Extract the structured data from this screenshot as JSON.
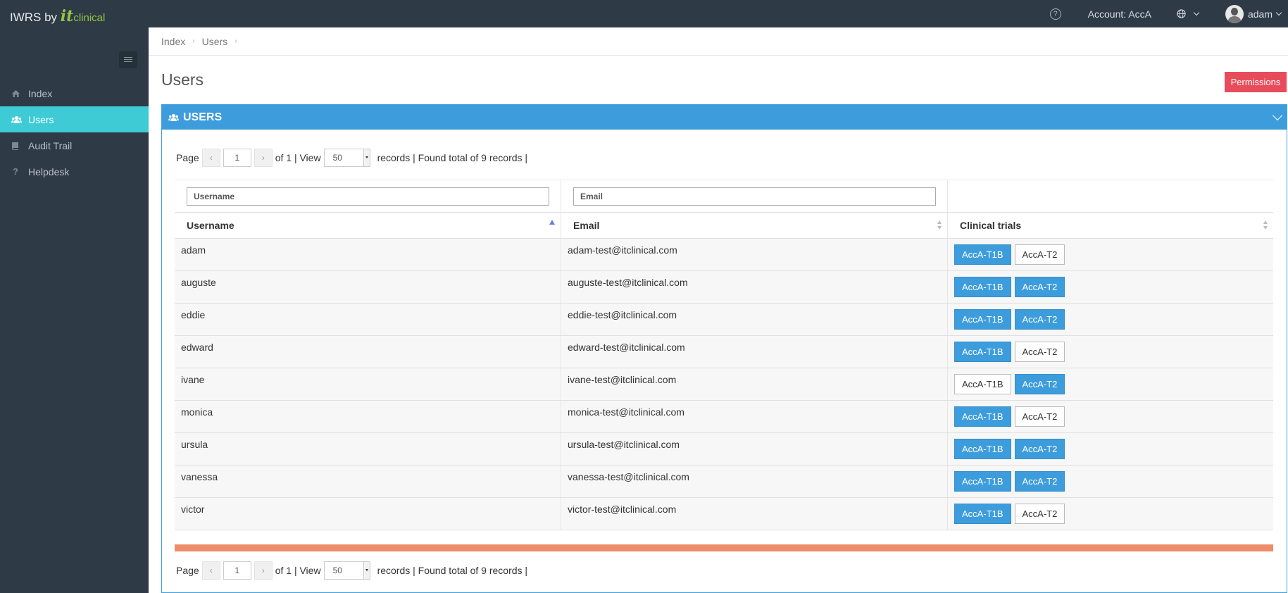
{
  "brand": {
    "text": "IWRS by",
    "logo_it": "it",
    "logo_clinical": "clinical"
  },
  "topbar": {
    "help": "?",
    "account": "Account: AccA",
    "user": "adam"
  },
  "sidebar": {
    "items": [
      {
        "label": "Index",
        "icon": "home-icon",
        "active": false
      },
      {
        "label": "Users",
        "icon": "users-icon",
        "active": true
      },
      {
        "label": "Audit Trail",
        "icon": "book-icon",
        "active": false
      },
      {
        "label": "Helpdesk",
        "icon": "question-icon",
        "active": false
      }
    ]
  },
  "breadcrumb": {
    "items": [
      "Index",
      "Users"
    ],
    "sep": "›"
  },
  "page": {
    "title": "Users",
    "permissions_label": "Permissions"
  },
  "panel": {
    "title": "USERS"
  },
  "pager": {
    "page_label": "Page",
    "prev": "‹",
    "next": "›",
    "page": "1",
    "of_text": "of 1 | View",
    "view": "50",
    "records_text": "records | Found total of 9 records |"
  },
  "filters": {
    "username_placeholder": "Username",
    "email_placeholder": "Email"
  },
  "columns": [
    "Username",
    "Email",
    "Clinical trials"
  ],
  "trials": [
    "AccA-T1B",
    "AccA-T2"
  ],
  "rows": [
    {
      "username": "adam",
      "email": "adam-test@itclinical.com",
      "t1b": true,
      "t2": false
    },
    {
      "username": "auguste",
      "email": "auguste-test@itclinical.com",
      "t1b": true,
      "t2": true
    },
    {
      "username": "eddie",
      "email": "eddie-test@itclinical.com",
      "t1b": true,
      "t2": true
    },
    {
      "username": "edward",
      "email": "edward-test@itclinical.com",
      "t1b": true,
      "t2": false
    },
    {
      "username": "ivane",
      "email": "ivane-test@itclinical.com",
      "t1b": false,
      "t2": true
    },
    {
      "username": "monica",
      "email": "monica-test@itclinical.com",
      "t1b": true,
      "t2": false
    },
    {
      "username": "ursula",
      "email": "ursula-test@itclinical.com",
      "t1b": true,
      "t2": true
    },
    {
      "username": "vanessa",
      "email": "vanessa-test@itclinical.com",
      "t1b": true,
      "t2": true
    },
    {
      "username": "victor",
      "email": "victor-test@itclinical.com",
      "t1b": true,
      "t2": false
    }
  ],
  "colors": {
    "topbar": "#2e3a46",
    "accent": "#3d9ddc",
    "active_nav": "#3ecbd6",
    "danger": "#e84b5a",
    "warning_bar": "#ee8c6a"
  }
}
